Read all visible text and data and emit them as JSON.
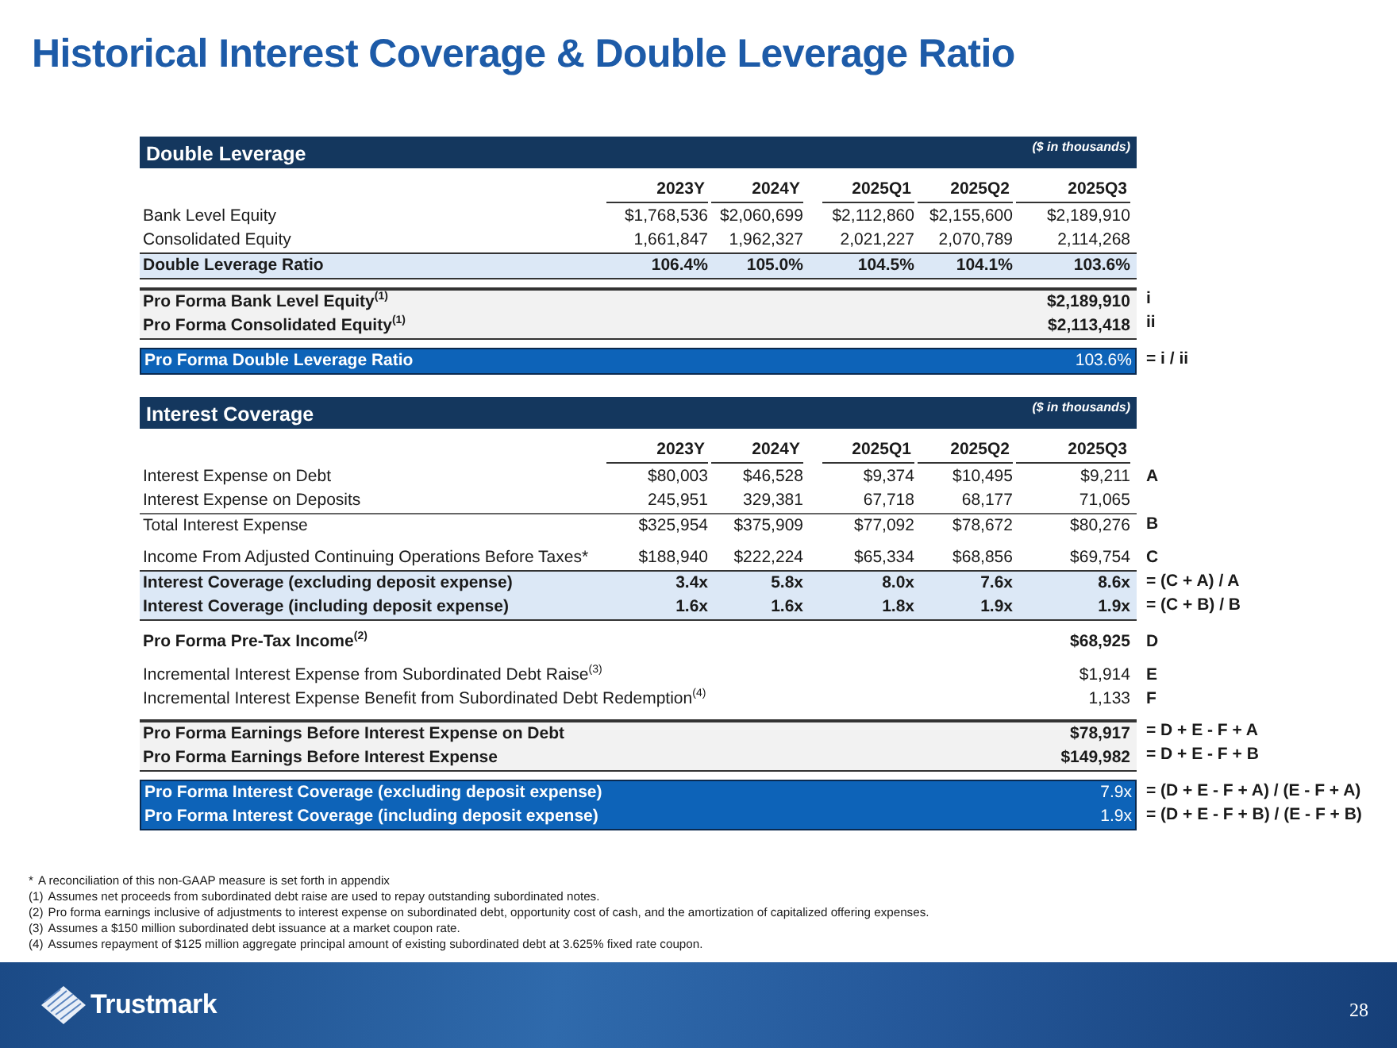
{
  "title": "Historical Interest Coverage & Double Leverage Ratio",
  "sections": [
    {
      "title": "Double Leverage",
      "unit_note": "($ in thousands)",
      "columns": [
        "2023Y",
        "2024Y",
        "2025Q1",
        "2025Q2",
        "2025Q3"
      ],
      "blocks": [
        {
          "kind": "plain",
          "rows": [
            {
              "label": "Bank Level Equity",
              "values": [
                "$1,768,536",
                "$2,060,699",
                "$2,112,860",
                "$2,155,600",
                "$2,189,910"
              ]
            },
            {
              "label": "Consolidated Equity",
              "values": [
                "1,661,847",
                "1,962,327",
                "2,021,227",
                "2,070,789",
                "2,114,268"
              ]
            }
          ]
        },
        {
          "kind": "ratio",
          "rows": [
            {
              "label": "Double Leverage Ratio",
              "values": [
                "106.4%",
                "105.0%",
                "104.5%",
                "104.1%",
                "103.6%"
              ]
            }
          ]
        },
        {
          "kind": "proforma",
          "rows": [
            {
              "label": "Pro Forma Bank Level Equity$^{(1)}$",
              "value": "$2,189,910",
              "formula": "i"
            },
            {
              "label": "Pro Forma Consolidated Equity$^{(1)}$",
              "value": "$2,113,418",
              "formula": "ii"
            }
          ]
        },
        {
          "kind": "highlight",
          "rows": [
            {
              "label": "Pro Forma Double Leverage Ratio",
              "value": "103.6%",
              "formula": "= i / ii"
            }
          ]
        }
      ]
    },
    {
      "title": "Interest Coverage",
      "unit_note": "($ in thousands)",
      "columns": [
        "2023Y",
        "2024Y",
        "2025Q1",
        "2025Q2",
        "2025Q3"
      ],
      "blocks": [
        {
          "kind": "plain",
          "rows": [
            {
              "label": "Interest Expense on Debt",
              "values": [
                "$80,003",
                "$46,528",
                "$9,374",
                "$10,495",
                "$9,211"
              ],
              "formula": "A"
            },
            {
              "label": "Interest Expense on Deposits",
              "values": [
                "245,951",
                "329,381",
                "67,718",
                "68,177",
                "71,065"
              ]
            }
          ]
        },
        {
          "kind": "total",
          "rows": [
            {
              "label": "Total Interest Expense",
              "values": [
                "$325,954",
                "$375,909",
                "$77,092",
                "$78,672",
                "$80,276"
              ],
              "formula": "B"
            }
          ]
        },
        {
          "kind": "plain",
          "rows": [
            {
              "label": "Income From Adjusted Continuing Operations Before Taxes*",
              "values": [
                "$188,940",
                "$222,224",
                "$65,334",
                "$68,856",
                "$69,754"
              ],
              "formula": "C"
            }
          ]
        },
        {
          "kind": "ratio",
          "rows": [
            {
              "label": "Interest Coverage (excluding deposit expense)",
              "values": [
                "3.4x",
                "5.8x",
                "8.0x",
                "7.6x",
                "8.6x"
              ],
              "formula": "= (C + A) / A"
            },
            {
              "label": "Interest Coverage (including deposit expense)",
              "values": [
                "1.6x",
                "1.6x",
                "1.8x",
                "1.9x",
                "1.9x"
              ],
              "formula": "= (C + B) / B"
            }
          ]
        },
        {
          "kind": "bold",
          "rows": [
            {
              "label": "Pro Forma Pre-Tax Income$^{(2)}$",
              "value": "$68,925",
              "formula": "D"
            }
          ]
        },
        {
          "kind": "plain",
          "rows": [
            {
              "label": "Incremental Interest Expense from Subordinated Debt Raise$^{(3)}$",
              "value": "$1,914",
              "formula": "E"
            },
            {
              "label": "Incremental Interest Expense Benefit from Subordinated Debt Redemption$^{(4)}$",
              "value": "1,133",
              "formula": "F"
            }
          ]
        },
        {
          "kind": "proforma",
          "rows": [
            {
              "label": "Pro Forma Earnings Before Interest Expense on Debt",
              "value": "$78,917",
              "formula": "= D + E - F + A"
            },
            {
              "label": "Pro Forma Earnings Before Interest Expense",
              "value": "$149,982",
              "formula": "= D + E - F + B"
            }
          ]
        },
        {
          "kind": "highlight",
          "rows": [
            {
              "label": "Pro Forma Interest Coverage (excluding deposit expense)",
              "value": "7.9x",
              "formula": "= (D + E - F + A) / (E - F + A)"
            },
            {
              "label": "Pro Forma Interest Coverage (including deposit expense)",
              "value": "1.9x",
              "formula": "= (D + E - F + B) / (E - F + B)"
            }
          ]
        }
      ]
    }
  ],
  "footnotes": [
    {
      "marker": "*",
      "text": "A reconciliation of this non-GAAP measure is set forth in appendix"
    },
    {
      "marker": "(1)",
      "text": "Assumes net proceeds from subordinated debt raise are used to repay outstanding subordinated notes."
    },
    {
      "marker": "(2)",
      "text": "Pro forma earnings inclusive of adjustments to interest expense on subordinated debt, opportunity cost of cash, and the amortization of capitalized offering expenses."
    },
    {
      "marker": "(3)",
      "text": "Assumes a $150 million subordinated debt issuance at a market coupon rate."
    },
    {
      "marker": "(4)",
      "text": "Assumes repayment of $125 million aggregate principal amount of existing subordinated debt at 3.625% fixed rate coupon."
    }
  ],
  "footer": {
    "logo_text": "Trustmark",
    "page_number": "28"
  }
}
